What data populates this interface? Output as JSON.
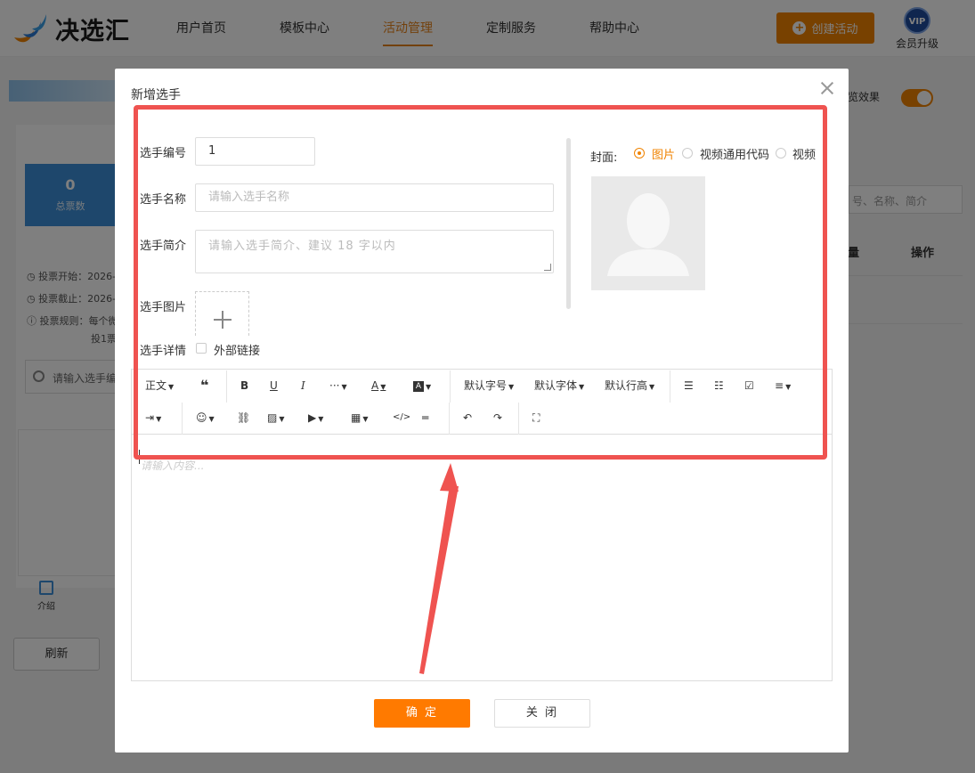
{
  "header": {
    "logo_text": "决选汇",
    "nav": [
      "用户首页",
      "模板中心",
      "活动管理",
      "定制服务",
      "帮助中心"
    ],
    "active_nav": "活动管理",
    "create_button": "创建活动",
    "vip_badge": "VIP",
    "vip_label": "会员升级",
    "colors": {
      "accent": "#f08300",
      "brand_blue": "#3c8fd8"
    }
  },
  "background": {
    "stat_value": "0",
    "stat_label": "总票数",
    "info_lines": [
      "投票开始：2026-",
      "投票截止：2026-",
      "投票规则：每个微",
      "投1票"
    ],
    "search_placeholder": "请输入选手编",
    "tab_label": "介绍",
    "refresh_button": "刷新",
    "preview_label": "览效果",
    "search_right_placeholder": "号、名称、简介",
    "col_partial": "量",
    "col_operation": "操作"
  },
  "modal": {
    "title": "新增选手",
    "fields": {
      "number_label": "选手编号",
      "number_value": "1",
      "name_label": "选手名称",
      "name_placeholder": "请输入选手名称",
      "intro_label": "选手简介",
      "intro_placeholder": "请输入选手简介、建议 18 字以内",
      "image_label": "选手图片",
      "detail_label": "选手详情",
      "external_link_label": "外部链接"
    },
    "cover": {
      "label": "封面:",
      "options": [
        "图片",
        "视频通用代码",
        "视频"
      ],
      "selected": "图片"
    },
    "editor": {
      "toolbar_row1": {
        "paragraph": "正文",
        "font_size": "默认字号",
        "font_family": "默认字体",
        "line_height": "默认行高"
      },
      "placeholder": "请输入内容..."
    },
    "confirm_button": "确 定",
    "close_button": "关 闭"
  }
}
